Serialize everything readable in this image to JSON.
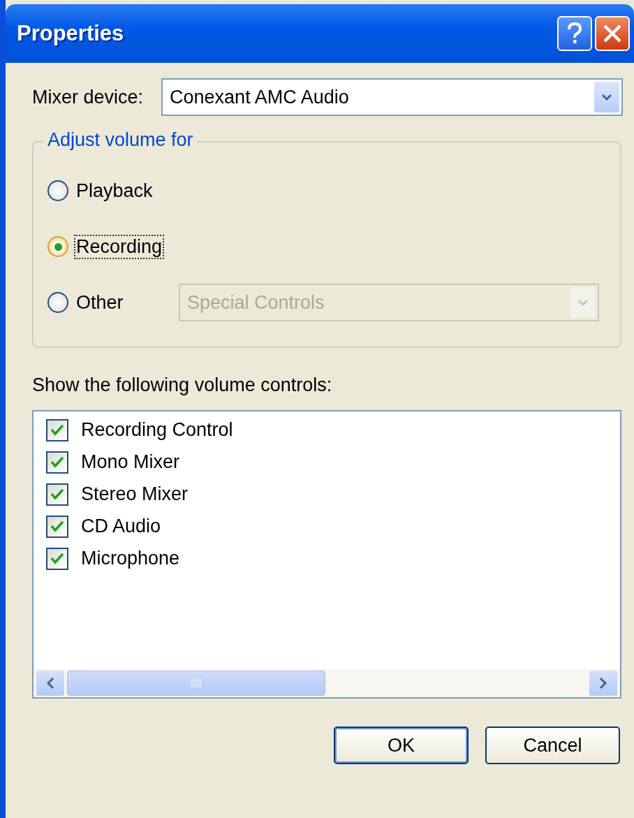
{
  "window": {
    "title": "Properties"
  },
  "mixer_device": {
    "label": "Mixer device:",
    "value": "Conexant AMC Audio"
  },
  "adjust_volume": {
    "legend": "Adjust volume for",
    "options": [
      {
        "label": "Playback",
        "selected": false,
        "focused": false
      },
      {
        "label": "Recording",
        "selected": true,
        "focused": true
      },
      {
        "label": "Other",
        "selected": false,
        "focused": false,
        "dropdown": {
          "value": "Special Controls",
          "disabled": true
        }
      }
    ]
  },
  "controls_list": {
    "label": "Show the following volume controls:",
    "items": [
      {
        "label": "Recording Control",
        "checked": true
      },
      {
        "label": "Mono Mixer",
        "checked": true
      },
      {
        "label": "Stereo Mixer",
        "checked": true
      },
      {
        "label": "CD Audio",
        "checked": true
      },
      {
        "label": "Microphone",
        "checked": true
      }
    ]
  },
  "buttons": [
    {
      "label": "OK",
      "default": true
    },
    {
      "label": "Cancel",
      "default": false
    }
  ]
}
